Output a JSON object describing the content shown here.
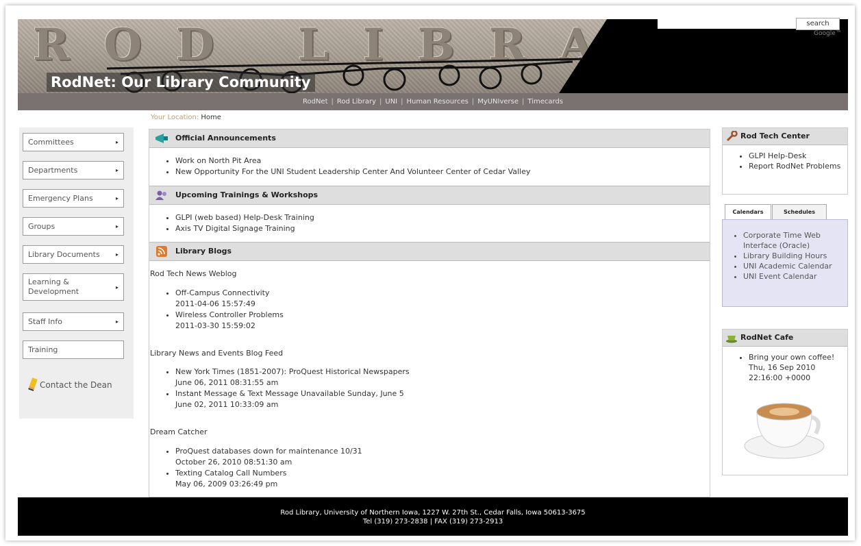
{
  "header": {
    "stone_text": "ROD LIBRARY",
    "title": "RodNet: Our Library Community",
    "search_button": "search",
    "search_provider": "Google™"
  },
  "topnav": [
    "RodNet",
    "Rod Library",
    "UNI",
    "Human Resources",
    "MyUNIverse",
    "Timecards"
  ],
  "location": {
    "label": "Your Location:",
    "value": "Home"
  },
  "sidebar": {
    "items": [
      {
        "label": "Committees",
        "arrow": "▸"
      },
      {
        "label": "Departments",
        "arrow": "▸"
      },
      {
        "label": "Emergency Plans",
        "arrow": "▸"
      },
      {
        "label": "Groups",
        "arrow": "▸"
      },
      {
        "label": "Library Documents",
        "arrow": "▸"
      },
      {
        "label": "Learning & Development",
        "arrow": "▸"
      },
      {
        "label": "Staff Info",
        "arrow": "▸"
      },
      {
        "label": "Training",
        "arrow": ""
      }
    ],
    "contact": "Contact the Dean"
  },
  "main": {
    "announcements": {
      "title": "Official Announcements",
      "icon": "megaphone-icon",
      "items": [
        "Work on North Pit Area",
        "New Opportunity For the UNI Student Leadership Center And Volunteer Center of Cedar Valley"
      ]
    },
    "trainings": {
      "title": "Upcoming Trainings & Workshops",
      "icon": "people-icon",
      "items": [
        "GLPI (web based) Help-Desk Training",
        "Axis TV Digital Signage Training"
      ]
    },
    "blogs": {
      "title": "Library Blogs",
      "icon": "rss-icon",
      "feeds": [
        {
          "name": "Rod Tech News Weblog",
          "entries": [
            {
              "title": "Off-Campus Connectivity",
              "date": "2011-04-06 15:57:49"
            },
            {
              "title": "Wireless Controller Problems",
              "date": "2011-03-30 15:59:02"
            }
          ]
        },
        {
          "name": "Library News and Events Blog Feed",
          "entries": [
            {
              "title": "New York Times (1851-2007): ProQuest Historical Newspapers",
              "date": "June 06, 2011 08:31:55 am"
            },
            {
              "title": "Instant Message & Text Message Unavailable Sunday, June 5",
              "date": "June 02, 2011 10:33:09 am"
            }
          ]
        },
        {
          "name": "Dream Catcher",
          "entries": [
            {
              "title": "ProQuest databases down for maintenance 10/31",
              "date": "October 26, 2010 08:51:30 am"
            },
            {
              "title": "Texting Catalog Call Numbers",
              "date": "May 06, 2009 03:26:49 pm"
            }
          ]
        }
      ]
    }
  },
  "right": {
    "tech_center": {
      "title": "Rod Tech Center",
      "icon": "wrench-icon",
      "items": [
        "GLPI Help-Desk",
        "Report RodNet Problems"
      ]
    },
    "tabs": {
      "labels": [
        "Calendars",
        "Schedules"
      ],
      "items": [
        "Corporate Time Web Interface (Oracle)",
        "Library Building Hours",
        "UNI Academic Calendar",
        "UNI Event Calendar"
      ]
    },
    "cafe": {
      "title": "RodNet Cafe",
      "icon": "coffee-icon",
      "items": [
        {
          "title": "Bring your own coffee!",
          "date": "Thu, 16 Sep 2010 22:16:00 +0000"
        }
      ]
    }
  },
  "footer": {
    "line1": "Rod Library, University of Northern Iowa, 1227 W. 27th St., Cedar Falls, Iowa 50613-3675",
    "line2": "Tel (319) 273-2838 | FAX (319) 273-2913"
  }
}
